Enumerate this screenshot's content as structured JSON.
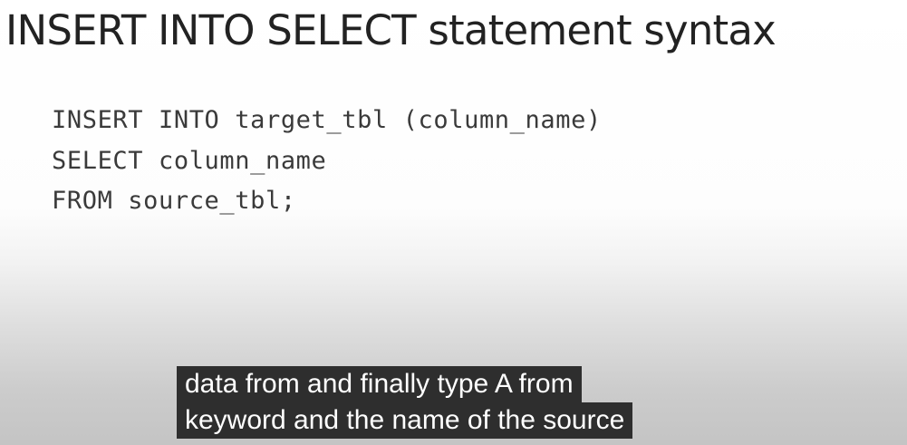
{
  "slide": {
    "title": "INSERT INTO SELECT statement syntax",
    "code_lines": [
      "INSERT INTO target_tbl (column_name)",
      "SELECT column_name",
      "FROM source_tbl;"
    ]
  },
  "captions": {
    "lines": [
      "data from and finally type A from",
      "keyword and the name of the source"
    ]
  }
}
